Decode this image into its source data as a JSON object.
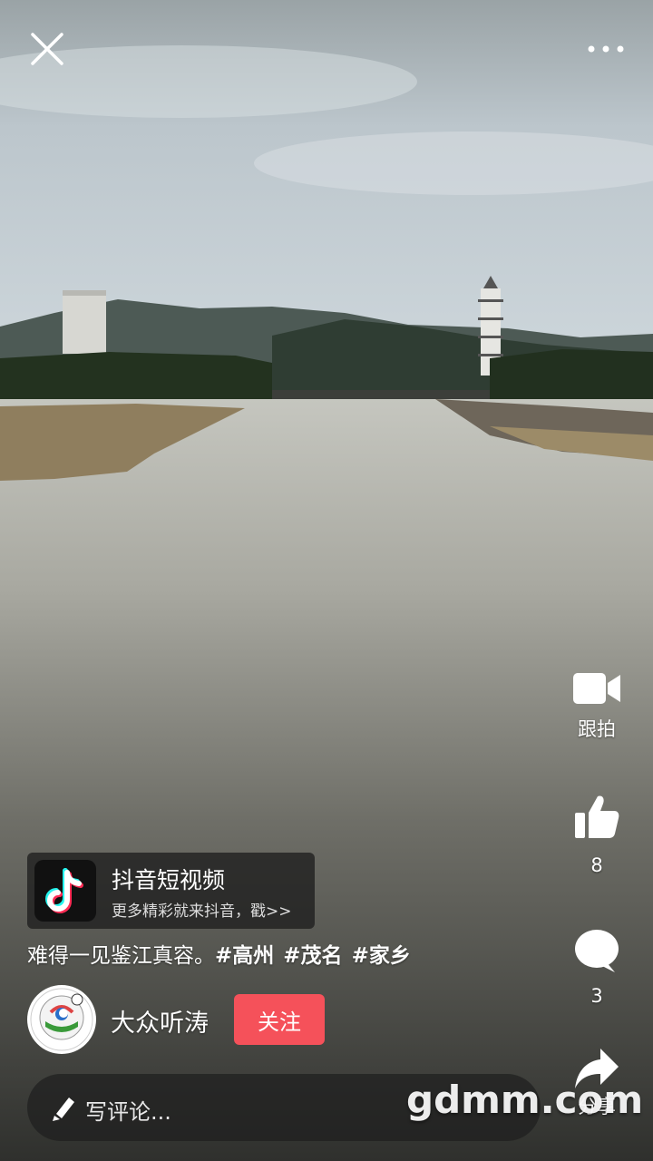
{
  "actions": {
    "shoot_label": "跟拍",
    "like_count": "8",
    "comment_count": "3",
    "share_label": "分享"
  },
  "promo": {
    "title": "抖音短视频",
    "subtitle": "更多精彩就来抖音，戳>>"
  },
  "caption": {
    "text": "难得一见鉴江真容。",
    "tags": [
      "#高州",
      "#茂名",
      "#家乡"
    ]
  },
  "author": {
    "name": "大众听涛",
    "follow_label": "关注"
  },
  "comment": {
    "placeholder": "写评论..."
  },
  "watermark": "gdmm.com",
  "icons": {
    "close": "close-icon",
    "more": "more-icon",
    "camera": "video-camera-icon",
    "like": "thumbs-up-icon",
    "comment": "speech-bubble-icon",
    "share": "share-arrow-icon",
    "edit": "pencil-icon"
  },
  "colors": {
    "follow_button": "#f5515a",
    "overlay": "#1e1e1e"
  }
}
